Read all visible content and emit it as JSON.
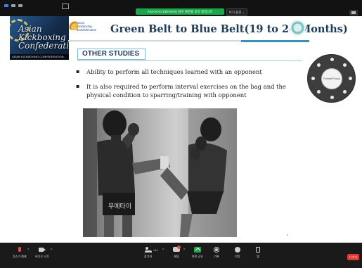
{
  "meeting": {
    "share_status": "ASIAN KICKBOXING 님이 화면을 공유 중입니다",
    "view_label": "보기 옵션 ⌄",
    "leave_label": "나가기"
  },
  "participant": {
    "name": "ASIAN KICKBOXING CONFEDERATION...",
    "overlay_lines": [
      "Asian",
      "Kickboxing",
      "Confederatio"
    ]
  },
  "slide": {
    "logo_lines": [
      "Asian",
      "Kickboxing",
      "Confederation"
    ],
    "title": "Green Belt to Blue Belt(19 to 24 Months)",
    "section_heading": "OTHER STUDIES",
    "bullets": [
      "Ability to perform all techniques learned with an opponent",
      "It is also required to perform interval exercises on the bag and the physical condition to sparring/training with opponent"
    ],
    "bullet_glyph": "▪",
    "photo_shorts_text": "무에타이"
  },
  "radial_menu": {
    "center_label": "Pointer/Focus"
  },
  "toolbar": {
    "items": [
      {
        "label": "음소거 해제",
        "icon": "mic-muted-icon"
      },
      {
        "label": "비디오 시작",
        "icon": "video-icon"
      },
      {
        "label": "참가자",
        "icon": "participants-icon",
        "count": "144"
      },
      {
        "label": "채팅",
        "icon": "chat-icon"
      },
      {
        "label": "화면 공유",
        "icon": "share-screen-icon"
      },
      {
        "label": "기록",
        "icon": "record-icon"
      },
      {
        "label": "반응",
        "icon": "reactions-icon"
      },
      {
        "label": "앱",
        "icon": "apps-icon"
      }
    ],
    "caret": "^"
  },
  "colors": {
    "share_green": "#1aa64a",
    "leave_red": "#d93a32",
    "title_navy": "#1f3b57",
    "accent_blue": "#3a8fb7"
  }
}
